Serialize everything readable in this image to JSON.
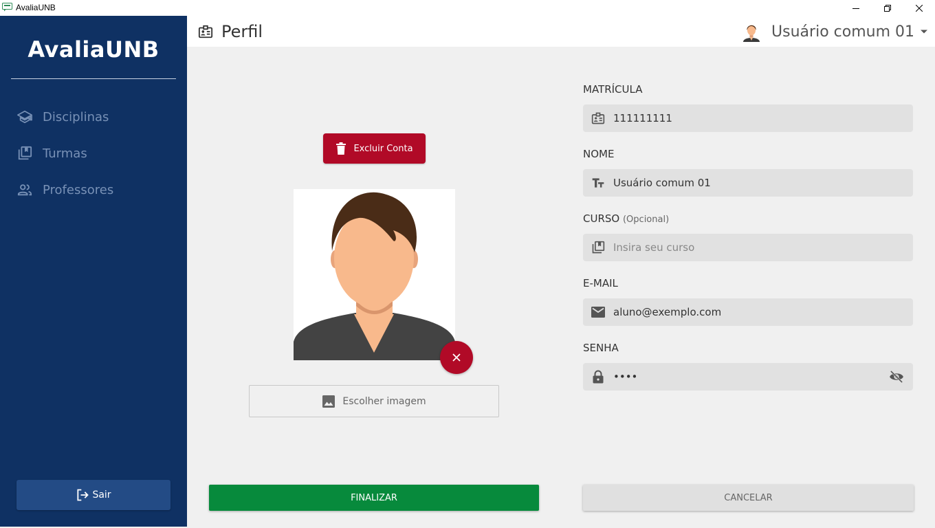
{
  "window": {
    "title": "AvaliaUNB"
  },
  "sidebar": {
    "brand": "AvaliaUNB",
    "items": [
      {
        "label": "Disciplinas",
        "icon": "school-icon"
      },
      {
        "label": "Turmas",
        "icon": "library-icon"
      },
      {
        "label": "Professores",
        "icon": "people-icon"
      }
    ],
    "logout_label": "Sair"
  },
  "header": {
    "title": "Perfil",
    "user_name": "Usuário comum 01"
  },
  "profile": {
    "delete_label": "Excluir Conta",
    "choose_image_label": "Escolher imagem"
  },
  "form": {
    "matricula": {
      "label": "MATRÍCULA",
      "value": "111111111"
    },
    "nome": {
      "label": "NOME",
      "value": "Usuário comum 01"
    },
    "curso": {
      "label": "CURSO",
      "optional": "(Opcional)",
      "placeholder": "Insira seu curso"
    },
    "email": {
      "label": "E-MAIL",
      "value": "aluno@exemplo.com"
    },
    "senha": {
      "label": "SENHA",
      "value": "••••"
    }
  },
  "actions": {
    "finish_label": "FINALIZAR",
    "cancel_label": "CANCELAR"
  },
  "colors": {
    "sidebar": "#0f3163",
    "danger": "#b10a27",
    "success": "#078a3c"
  }
}
